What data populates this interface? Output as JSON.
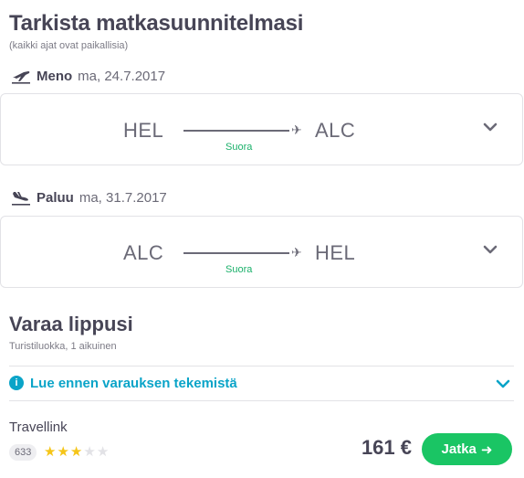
{
  "header": {
    "title": "Tarkista matkasuunnitelmasi",
    "subtitle": "(kaikki ajat ovat paikallisia)"
  },
  "outbound": {
    "direction": "Meno",
    "date": "ma, 24.7.2017",
    "from": "HEL",
    "to": "ALC",
    "stops": "Suora"
  },
  "return": {
    "direction": "Paluu",
    "date": "ma, 31.7.2017",
    "from": "ALC",
    "to": "HEL",
    "stops": "Suora"
  },
  "booking": {
    "title": "Varaa lippusi",
    "subtitle": "Turistiluokka, 1 aikuinen",
    "notice": "Lue ennen varauksen tekemistä",
    "provider": "Travellink",
    "review_count": "633",
    "rating": 3,
    "rating_max": 5,
    "price": "161 €",
    "cta_label": "Jatka"
  },
  "icons": {
    "takeoff": "airplane-takeoff-icon",
    "landing": "airplane-landing-icon",
    "chevron": "chevron-down-icon",
    "info": "info-icon",
    "arrow": "arrow-right-icon"
  },
  "colors": {
    "text": "#474556",
    "stops": "#1ab06a",
    "notice": "#0aa4c8",
    "cta": "#1ac564",
    "star_on": "#f5c518",
    "star_off": "#e2e2e6"
  }
}
